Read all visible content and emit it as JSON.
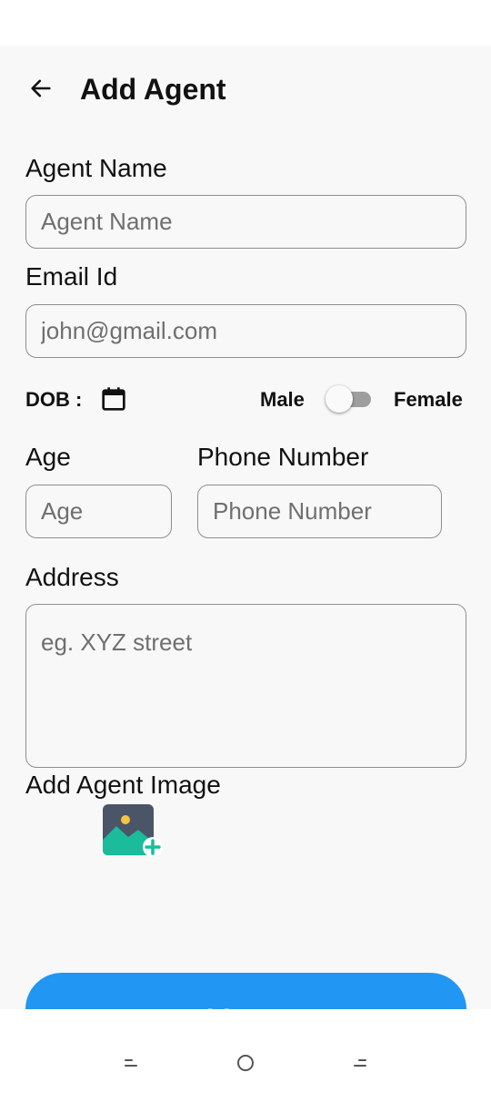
{
  "header": {
    "title": "Add Agent"
  },
  "form": {
    "name": {
      "label": "Agent Name",
      "placeholder": "Agent Name"
    },
    "email": {
      "label": "Email Id",
      "placeholder": "john@gmail.com"
    },
    "dob": {
      "label": "DOB :"
    },
    "gender": {
      "left_label": "Male",
      "right_label": "Female",
      "is_female": false
    },
    "age": {
      "label": "Age",
      "placeholder": "Age"
    },
    "phone": {
      "label": "Phone Number",
      "placeholder": "Phone Number"
    },
    "address": {
      "label": "Address",
      "placeholder": "eg. XYZ street"
    },
    "image": {
      "label": "Add Agent Image"
    },
    "submit_label": "Add Agent"
  },
  "icons": {
    "back": "arrow-left-icon",
    "calendar": "calendar-icon",
    "add_image": "add-image-icon"
  },
  "colors": {
    "primary": "#2196f3",
    "image_icon_bg": "#4a5568",
    "image_icon_accent": "#1abc9c",
    "sun": "#f6c343"
  }
}
